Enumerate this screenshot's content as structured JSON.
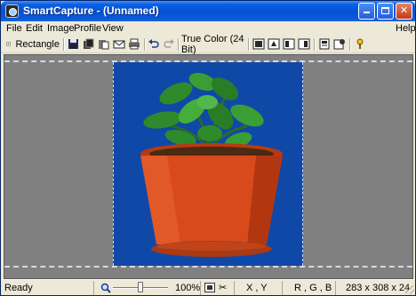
{
  "window": {
    "title": "SmartCapture - (Unnamed)",
    "controls": {
      "minimize": "_",
      "maximize": "□",
      "close": "✕"
    }
  },
  "menu": {
    "items": [
      "File",
      "Edit",
      "Image",
      "Profile",
      "View"
    ],
    "help": "Help"
  },
  "toolbar": {
    "capture_mode": "Rectangle",
    "color_mode": "True Color (24 Bit)",
    "icons": [
      "capture-rectangle-icon",
      "save-icon",
      "copy-icon",
      "paste-icon",
      "email-icon",
      "print-icon",
      "undo-icon",
      "redo-icon",
      "resize-icon",
      "crop-icon",
      "flip-icon",
      "rotate-icon",
      "properties-icon",
      "settings-icon",
      "help-icon"
    ]
  },
  "status": {
    "ready": "Ready",
    "zoom": "100%",
    "zoom_level": 1.0,
    "coords": "X , Y",
    "color": "R , G , B",
    "dimensions": "283 x 308 x 24"
  },
  "colors": {
    "title_bar": "#0450d6",
    "canvas_bg": "#808080",
    "image_bg": "#1048a8",
    "pot": "#d84a1c",
    "leaves": "#2e8a2a"
  }
}
